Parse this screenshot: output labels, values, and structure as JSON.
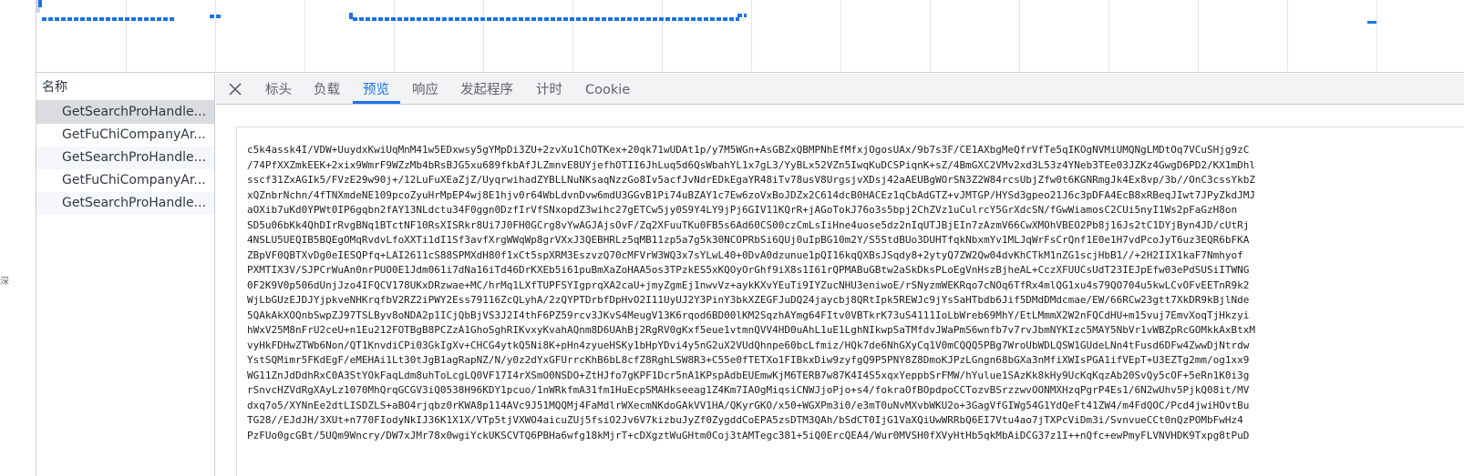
{
  "gutter_glyph": "深",
  "list": {
    "header": "名称",
    "rows": [
      "GetSearchProHandle...",
      "GetFuChiCompanyAr...",
      "GetSearchProHandle...",
      "GetFuChiCompanyAr...",
      "GetSearchProHandle..."
    ]
  },
  "tabs": [
    "标头",
    "负载",
    "预览",
    "响应",
    "发起程序",
    "计时",
    "Cookie"
  ],
  "active_tab": "预览",
  "preview_lines": [
    "c5k4assk4I/VDW+UuydxKwiUqMnM41w5EDxwsy5gYMpDi3ZU+2zvXu1ChOTKex+20qk71wUDAt1p/y7M5WGn+AsGBZxQBMPNhEfMfxjOgosUAx/9b7s3F/CE1AXbgMeQfrVfTe5qIKOgNVMiUMQNgLMDtOq7VCuSHjg9zC",
    "/74PfXXZmkEEK+2xix9WmrF9WZzMb4bRsBJG5xu689fkbAfJLZmnvE8UYjefhOTII6JhLuq5d6QsWbahYL1x7gL3/YyBLx52VZn5IwqKuDCSPiqnK+sZ/4BmGXC2VMv2xd3L53z4YNeb3TEe03JZKz4GwgD6PD2/KX1mDhl",
    "sscf31ZxAGIk5/FVzE29w90j+/12LuFuXEaZjZ/UyqrwihadZYBLLNuNKsaqNzzGo8Iv5acfJvNdrEDkEgaYR48iTv78usV8UrgsjvXDsj42aAEUBgWOrSN3Z2W84rcsUbjZfw0t6KGNRmgJk4Ex8vp/3b//OnC3cssYkbZ",
    "xQZnbrNchn/4fTNXmdeNE109pcoZyuHrMpEP4wj8E1hjv0r64WbLdvnDvw6mdU3GGvB1Pi74uBZAY1c7Ew6zoVxBoJDZx2C614dcB0HACEz1qCbAdGTZ+vJMTGP/HYSd3gpeo21J6c3pDFA4EcB8xRBeqJIwt7JPyZkdJMJ",
    "aOXib7uKd0YPWt0IP6gqbn2fAY13NLdctu34F0ggn0DzfIrVfSNxopdZ3wihc27gETCw5jy0S9Y4LY9jPj6GIV11KQrR+jAGoTokJ76o3s5bpj2ChZVz1uCulrcY5GrXdcSN/fGwWiamosC2CUi5nyI1Ws2pFaGzH8on",
    "SD5u06bKk4QhDIrRvgBNq1BTctNF10RsXISRkr8Ui7J0FH0GCrg8vYwAGJAjsOvF/Zq2XFuuTKu0FB5s6Ad60CS00czCmLsIiHne4uose5dz2nIqUTJBjEIn7zAzmV66CwXMOhVBEO2Pb8j16Js2tC1DYjByn4JD/cUtRj",
    "4NSLU5UEQIB5BQEgOMqRvdvLfoXXTi1dI1Sf3avfXrgWWqWp8grVXxJ3QEBHRLz5qMB11zp5a7g5k30NCOPRbSi6QUj0uIpBG10m2Y/S5StdBUo3DUHTfqkNbxmYv1MLJqWrFsCrQnf1E0e1H7vdPcoJyT6uz3EQR6bFKA",
    "ZBpVF0QBTXvDg0eIESQPfq+LAI2611cS88SPMXdH80f1xCt5spXRM3EszvzQ70cMFVrW3WQ3x7sYLwL40+0DvA0dzunue1pQI16kqQXBsJSqdy8+2ytyQ7ZW2Qw04dvKhCTkM1nZG1scjHbB1//+2H2IIX1kaF7Nmhyof",
    "PXMTIX3V/SJPCrWuAn0nrPUO0E1Jdm061i7dNa16iTd46DrKXEb5i61puBmXaZoHAA5os3TPzkES5xKQOyOrGhf9iX8s1I61rQPMABuGBtw2aSkDksPLoEgVnHszBjheAL+CczXFUUCsUdT23IEJpEfw03ePdSUSiITWNG",
    "0F2K9V0p506dUnjJzo4IFQCV178UKxDRzwae+MC/hrMq1LXfTUPFSYIgprqXA2caU+jmyZgmEj1nwvVz+aykKXvYEuTi9IYZucNHU3eniwoE/rSNyzmWEKRqo7cNOq6TfRx4mlQG1xu4s79QO704u5kwLCvOFvEETnR9k2",
    "WjLbGUzEJDJYjpkveNHKrqfbV2RZ2iPWY2Ess79116ZcQLyhA/2zQYPTDrbfDpHvO2I11UyUJ2Y3PinY3bkXZEGFJuDQ24jaycbj8QRtIpk5REWJc9jYsSaHTbdb6Jif5DMdDMdcmae/EW/66RCw23gtt7XkDR9kBjlNde",
    "5QAkAkXOQnbSwpZJ97TSLByv8oNDA2p1ICjQbBjVS3J2I4thF6PZ59rcv3JKvS4MeugV13K6rqod6BD00lKM2SqzhAYmg64FItv0VBTkrK73uS4111IoLbWreb69MhY/EtLMmmX2W2nFQCdHU+m15vuj7EmvXoqTjHkzyi",
    "hWxV25M8nFrU2ceU+n1Eu212FOTBgB8PCZzA1GhoSghRIKvxyKvahAQnm8D6UAhBj2RgRV0gKxf5eue1vtmnQVV4HD0uAhL1uE1LghNIkwpSaTMfdvJWaPmS6wnfb7v7rvJbmNYKIzc5MAY5NbVr1vWBZpRcGOMkkAxBtxM",
    "vyHkFDHwZTWb6Non/QT1KnvdiCPi03GkIgXv+CHCG4ytkQ5Ni8K+pHn4zyueHSKy1bHpYDvi4y5nG2uX2VUdQhnpe60bcLfmiz/HQk7de6NhGXyCq1V0mCQQQ5PBg7WroUbWDLQSW1GUdeLNn4tFusd6DFw4ZwwDjNtrdw",
    "YstSQMimr5FKdEgF/eMEHAi1Lt30tJgB1agRapNZ/N/y0z2dYxGFUrrcKhB6bL8cfZ8RghLSW8R3+C55e0fTETXo1FIBkxDiw9zyfgQ9P5PNY8Z8DmoKJPzLGngn68bGXa3nMfiXWIsPGA1ifVEpT+U3EZTg2mm/og1xx9",
    "WG11ZnJdDdhRxC0A3StYOkFaqLdm8uhToLcgLQ0VF17I4rXSmO0NSDO+ZtHJfo7gKPF1Dcr5nA1KPspAdbEUEmwKjM6TERB7w87K4I4S5xqxYeppbSrFMW/hYulue1SAzKk8kHy9UcKqKqzAb20SvQy5cOF+5eRn1K0i3g",
    "rSnvcHZVdRgXAyLz1070MhQrqGCGV3iQ0538H96KDY1pcuo/1nWRkfmA31fm1HuEcpSMAHkseeag1Z4Km7IAOgMiqsiCNWJjoPjo+s4/fokraOfBOpdpoCCTozvBSrzzwvOONMXHzqPgrP4Es1/6N2wUhv5PjkQ08it/MV",
    "dxq7o5/XYNnEe2dtLISDZLS+aBO4rjqbz0rKWA8p114AVc9J51MQQMj4FaMdlrWXecmNKdoGAkVV1HA/QKyrGKO/x50+WGXPm3i0/e3mT0uNvMXvbWKU2o+3GagVfGIWg54G1YdQeFt41ZW4/m4FdQOC/Pcd4jwiHOvtBu",
    "TG28//EJdJH/3XUt+n770FIodyNkIJ36K1X1X/VTp5tjVXWO4aicuZUj5fsiO2Jv6V7kizbuJyZf0ZygddCoEPA5zsDTM3QAh/bSdCT0IjG1VaXQiUwWRRbQ6EI7Vtu4ao7jTXPcViDm3i/SvnvueCCt0nQzPOMbFwHz4",
    "PzFUo0gcGBt/5UQm9Wncry/DW7xJMr78x0wgiYckUKSCVTQ6PBHa6wfg18kMjrT+cDXgztWuGHtm0Coj3tAMTegc381+5iQ0ErcQEA4/Wur0MVSH0fXVyHtHb5qkMbAiDCG37z1I++nQfc+ewPmyFLVNVHDK9Txpg8tPuD"
  ],
  "colors": {
    "accent": "#1a73e8",
    "selected_row": "#dadce0"
  },
  "icons": {
    "close": "close-icon"
  }
}
